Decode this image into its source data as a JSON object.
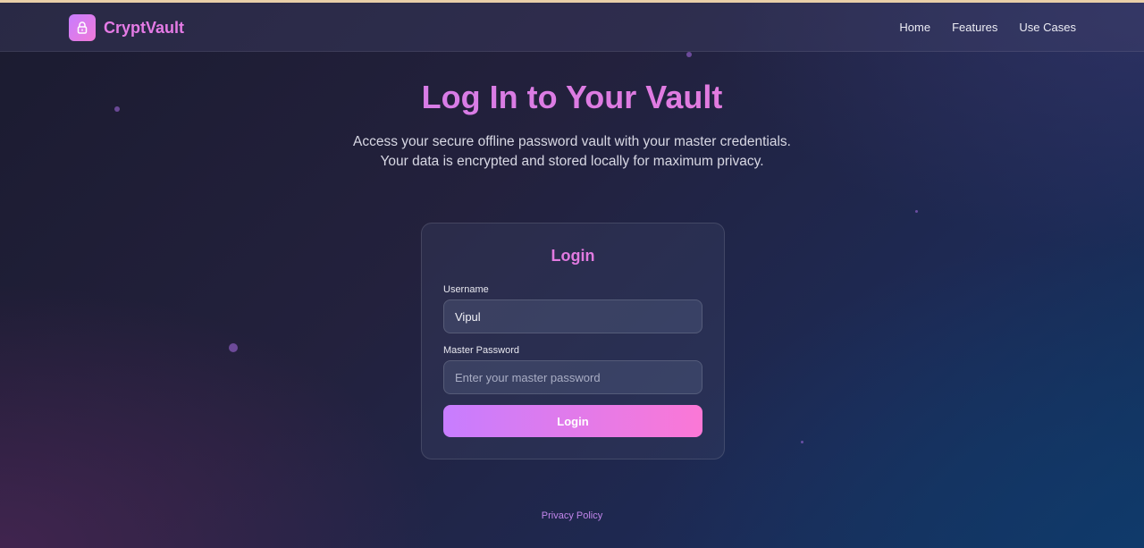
{
  "brand": {
    "name": "CryptVault",
    "logo_icon": "lock-icon",
    "accent": "#e57be6"
  },
  "nav": {
    "links": [
      "Home",
      "Features",
      "Use Cases"
    ]
  },
  "hero": {
    "title": "Log In to Your Vault",
    "subtitle": "Access your secure offline password vault with your master credentials. Your data is encrypted and stored locally for maximum privacy."
  },
  "login_card": {
    "title": "Login",
    "username_label": "Username",
    "username_value": "Vipul",
    "password_label": "Master Password",
    "password_placeholder": "Enter your master password",
    "password_value": "",
    "submit_label": "Login"
  },
  "footer": {
    "privacy_link": "Privacy Policy"
  },
  "colors": {
    "gradient_start": "#c77dff",
    "gradient_end": "#fb78d6",
    "background": "#1b1b30"
  }
}
